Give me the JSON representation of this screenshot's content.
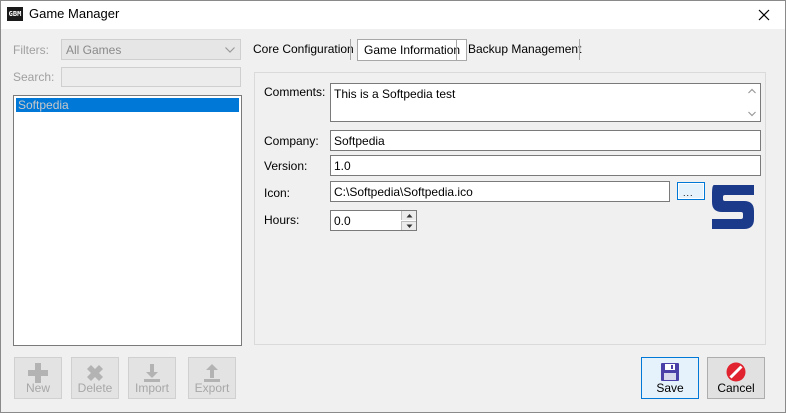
{
  "window": {
    "title": "Game Manager",
    "app_icon_text": "GBM"
  },
  "filters": {
    "label": "Filters:",
    "value": "All Games"
  },
  "search": {
    "label": "Search:",
    "value": ""
  },
  "game_list": {
    "items": [
      "Softpedia"
    ]
  },
  "toolbar": {
    "new_label": "New",
    "delete_label": "Delete",
    "import_label": "Import",
    "export_label": "Export"
  },
  "tabs": [
    {
      "label": "Core Configuration"
    },
    {
      "label": "Game Information"
    },
    {
      "label": "Backup Management"
    }
  ],
  "form": {
    "comments_label": "Comments:",
    "comments_value": "This is a Softpedia test",
    "company_label": "Company:",
    "company_value": "Softpedia",
    "version_label": "Version:",
    "version_value": "1.0",
    "icon_label": "Icon:",
    "icon_value": "C:\\Softpedia\\Softpedia.ico",
    "browse_label": "...",
    "hours_label": "Hours:",
    "hours_value": "0.0"
  },
  "actions": {
    "save_label": "Save",
    "cancel_label": "Cancel"
  },
  "colors": {
    "accent": "#0078d7",
    "logo": "#1b3a8a",
    "cancel_icon": "#e0232e",
    "save_icon": "#4b3fa8"
  }
}
